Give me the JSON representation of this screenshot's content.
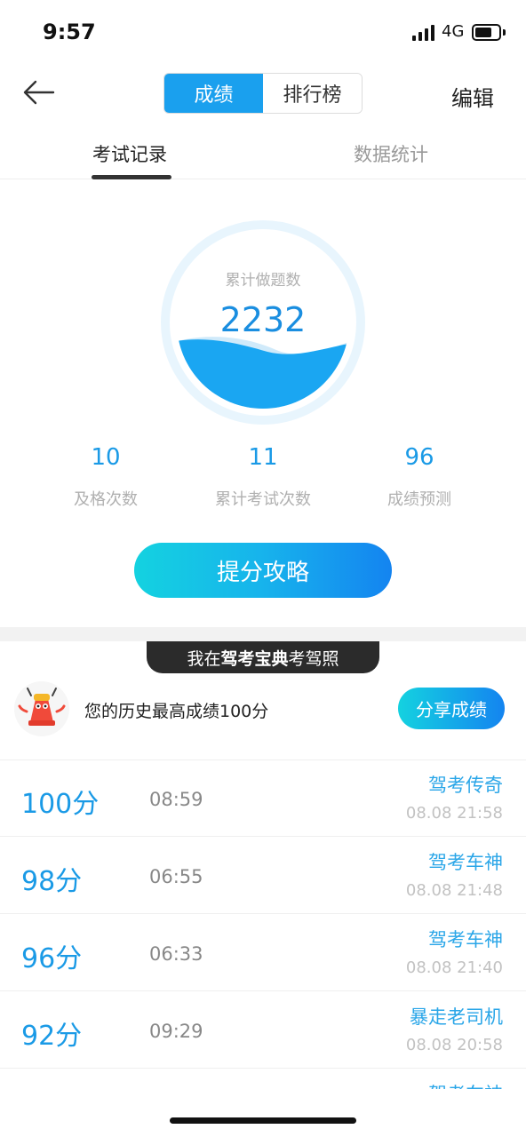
{
  "status_bar": {
    "time": "9:57",
    "network": "4G"
  },
  "header": {
    "segments": [
      "成绩",
      "排行榜"
    ],
    "active_segment": "成绩",
    "edit_label": "编辑"
  },
  "subtabs": [
    {
      "label": "考试记录",
      "active": true
    },
    {
      "label": "数据统计",
      "active": false
    }
  ],
  "summary": {
    "circle_label": "累计做题数",
    "circle_value": "2232",
    "stats": [
      {
        "value": "10",
        "label": "及格次数"
      },
      {
        "value": "11",
        "label": "累计考试次数"
      },
      {
        "value": "96",
        "label": "成绩预测"
      }
    ],
    "cta_label": "提分攻略"
  },
  "banner": {
    "prefix": "我在",
    "brand": "驾考宝典",
    "suffix": "考驾照"
  },
  "best": {
    "text": "您的历史最高成绩100分",
    "share_label": "分享成绩"
  },
  "records": [
    {
      "score": "100分",
      "duration": "08:59",
      "title": "驾考传奇",
      "date": "08.08 21:58"
    },
    {
      "score": "98分",
      "duration": "06:55",
      "title": "驾考车神",
      "date": "08.08 21:48"
    },
    {
      "score": "96分",
      "duration": "06:33",
      "title": "驾考车神",
      "date": "08.08 21:40"
    },
    {
      "score": "92分",
      "duration": "09:29",
      "title": "暴走老司机",
      "date": "08.08 20:58"
    }
  ],
  "partial_record": {
    "title": "驾考车神"
  },
  "colors": {
    "accent": "#1a9ae6",
    "segment_active": "#1aa0ee",
    "wave": "#1aa6f2"
  },
  "icons": {
    "back": "arrow-left-icon",
    "mascot": "mascot-avatar-icon"
  }
}
